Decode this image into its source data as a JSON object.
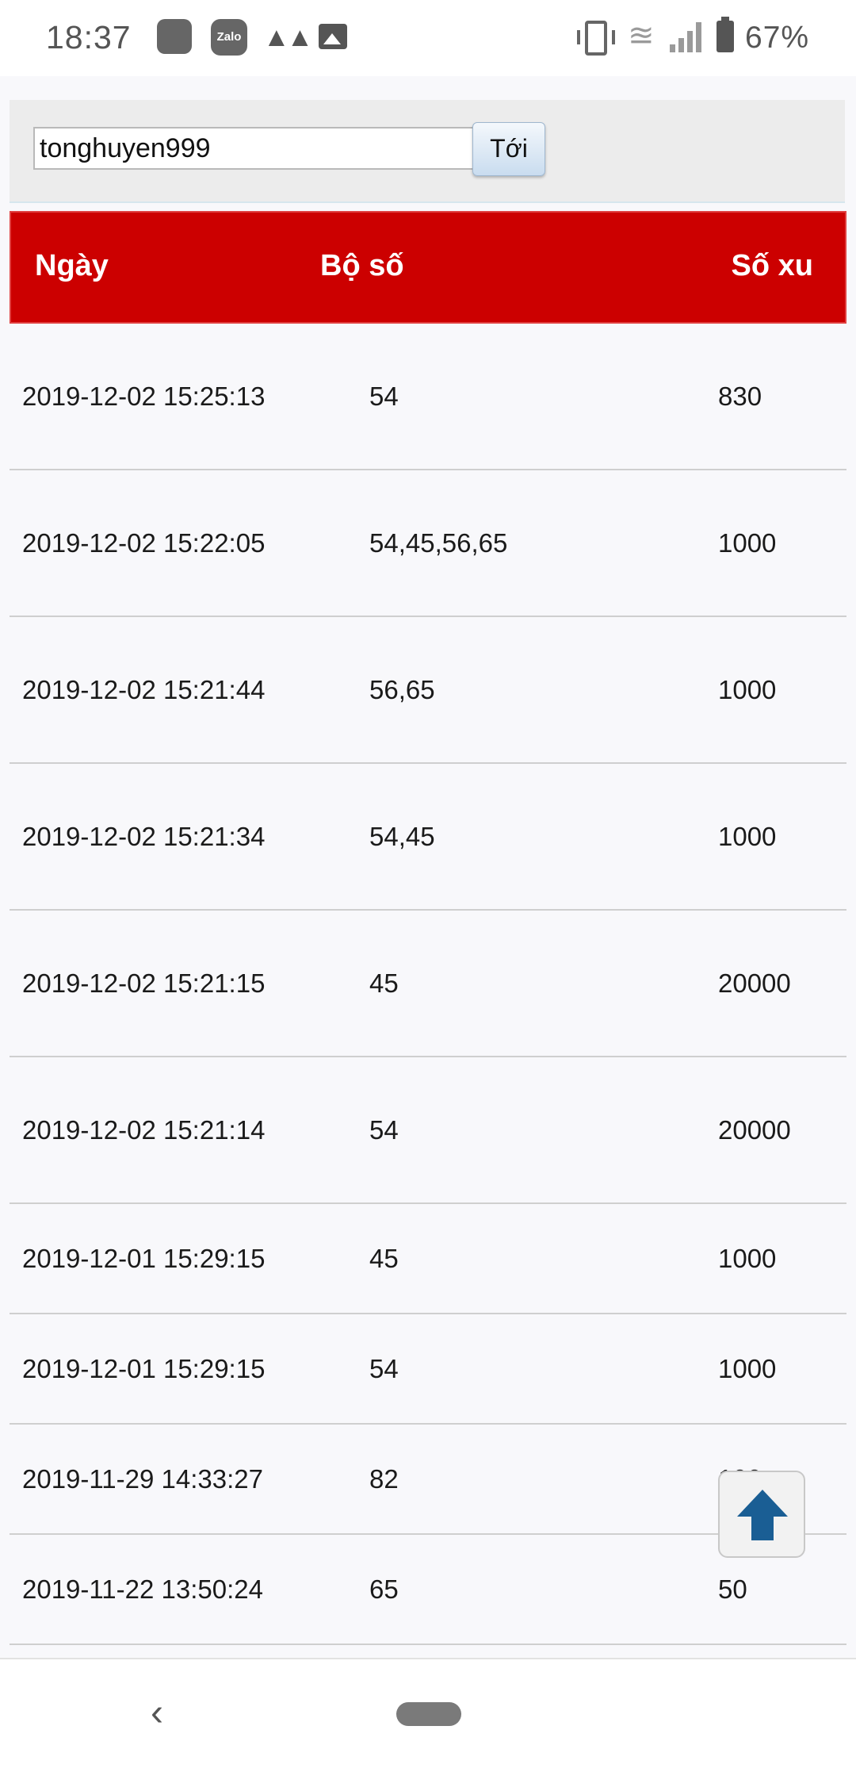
{
  "status_bar": {
    "time": "18:37",
    "zalo_label": "Zalo",
    "battery": "67%",
    "icons": [
      "app-icon",
      "zalo-icon",
      "m-app-icon",
      "image-icon",
      "vibrate-icon",
      "wifi-icon",
      "signal-icon",
      "battery-icon"
    ]
  },
  "form": {
    "username_value": "tonghuyen999",
    "go_label": "Tới"
  },
  "table": {
    "headers": {
      "date": "Ngày",
      "numbers": "Bộ số",
      "coins": "Số xu"
    },
    "header_color": "#cc0000",
    "rows": [
      {
        "date": "2019-12-02 15:25:13",
        "numbers": "54",
        "coins": "830"
      },
      {
        "date": "2019-12-02 15:22:05",
        "numbers": "54,45,56,65",
        "coins": "1000"
      },
      {
        "date": "2019-12-02 15:21:44",
        "numbers": "56,65",
        "coins": "1000"
      },
      {
        "date": "2019-12-02 15:21:34",
        "numbers": "54,45",
        "coins": "1000"
      },
      {
        "date": "2019-12-02 15:21:15",
        "numbers": "45",
        "coins": "20000"
      },
      {
        "date": "2019-12-02 15:21:14",
        "numbers": "54",
        "coins": "20000"
      },
      {
        "date": "2019-12-01 15:29:15",
        "numbers": "45",
        "coins": "1000"
      },
      {
        "date": "2019-12-01 15:29:15",
        "numbers": "54",
        "coins": "1000"
      },
      {
        "date": "2019-11-29 14:33:27",
        "numbers": "82",
        "coins": "100"
      },
      {
        "date": "2019-11-22 13:50:24",
        "numbers": "65",
        "coins": "50"
      }
    ]
  },
  "back_to_top": {
    "icon": "arrow-up-icon",
    "color": "#1a5e94"
  },
  "nav": {
    "back_icon": "back-chevron-icon",
    "home_icon": "home-pill-icon"
  }
}
